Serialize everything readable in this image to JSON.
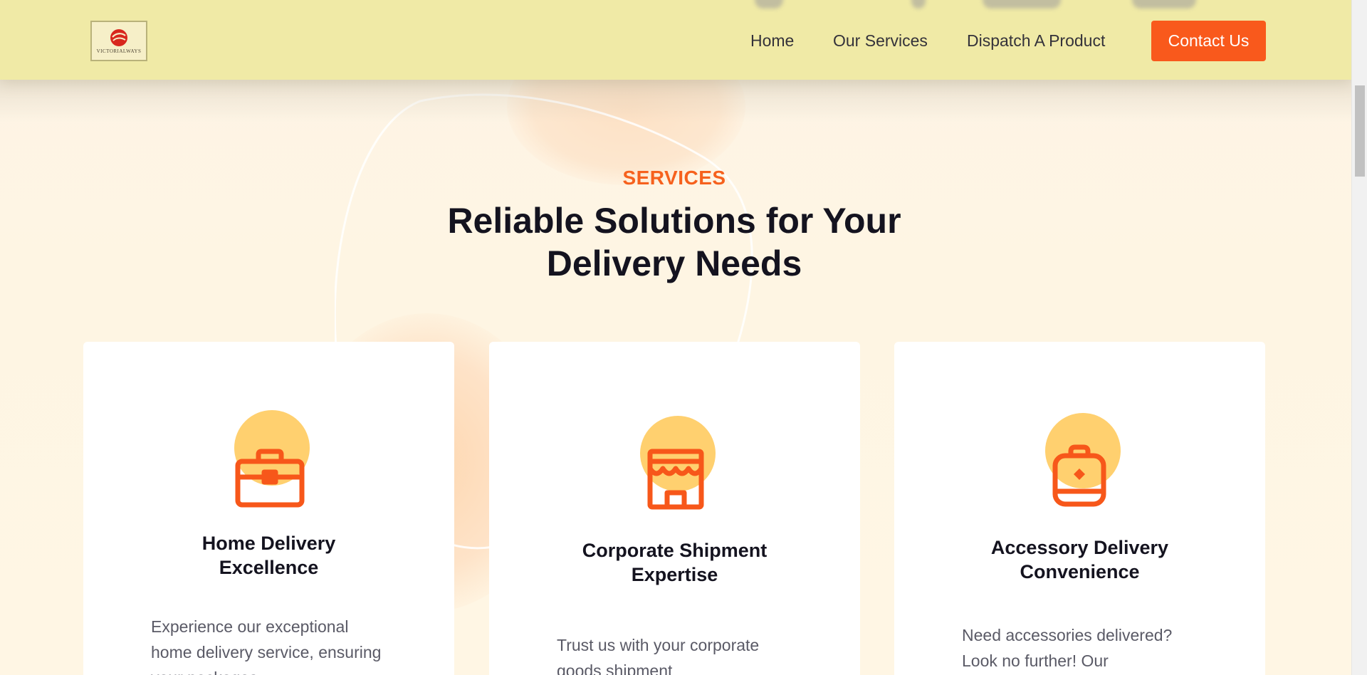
{
  "header": {
    "logo_text": "VICTORIALWAYS",
    "nav": {
      "home": "Home",
      "services": "Our Services",
      "dispatch": "Dispatch A Product",
      "contact": "Contact Us"
    }
  },
  "section": {
    "eyebrow": "SERVICES",
    "headline_line1": "Reliable Solutions for Your",
    "headline_line2": "Delivery Needs"
  },
  "cards": [
    {
      "icon": "briefcase-icon",
      "title_line1": "Home Delivery",
      "title_line2": "Excellence",
      "description": "Experience our exceptional home delivery service, ensuring your packages"
    },
    {
      "icon": "storefront-icon",
      "title_line1": "Corporate Shipment",
      "title_line2": "Expertise",
      "description": "Trust us with your corporate goods shipment"
    },
    {
      "icon": "backpack-icon",
      "title_line1": "Accessory Delivery",
      "title_line2": "Convenience",
      "description": "Need accessories delivered? Look no further! Our"
    }
  ],
  "colors": {
    "header_bg": "#f0eaa6",
    "accent": "#f9591c",
    "icon_circle": "#ffd06f",
    "heading": "#14131f"
  }
}
